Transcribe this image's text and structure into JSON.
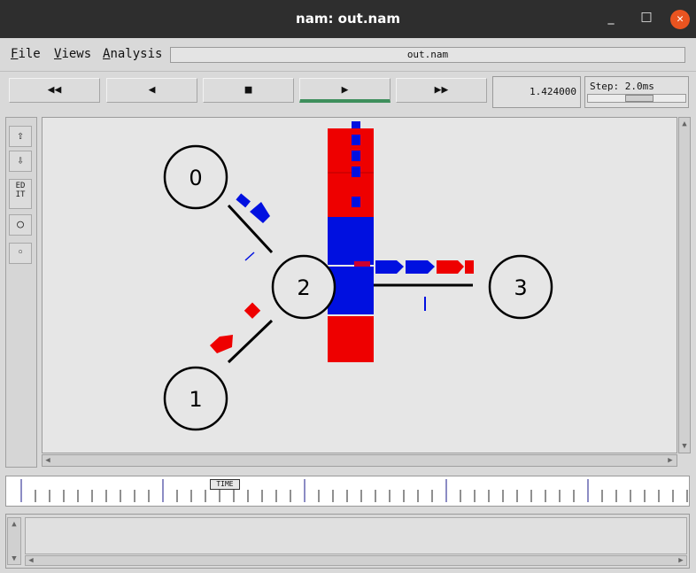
{
  "window": {
    "title": "nam: out.nam",
    "minimize": "_",
    "maximize": "□",
    "close": "✕"
  },
  "menu": {
    "file": {
      "key": "F",
      "rest": "ile"
    },
    "views": {
      "key": "V",
      "rest": "iews"
    },
    "analysis": {
      "key": "A",
      "rest": "nalysis"
    },
    "filename": "out.nam"
  },
  "controls": {
    "rewind": "◀◀",
    "back": "◀",
    "stop": "■",
    "play": "▶",
    "fast_forward": "▶▶",
    "current_time": "1.424000",
    "step_label": "Step: 2.0ms"
  },
  "tools": {
    "zoom_in_icon": "⇧",
    "zoom_out_icon": "⇩",
    "edit_label_line1": "ED",
    "edit_label_line2": "IT",
    "circle_tool": "○",
    "dot_tool": "◦"
  },
  "network": {
    "nodes": [
      {
        "id": "0",
        "label": "0"
      },
      {
        "id": "1",
        "label": "1"
      },
      {
        "id": "2",
        "label": "2"
      },
      {
        "id": "3",
        "label": "3"
      }
    ],
    "colors": {
      "flow_blue": "#0010e0",
      "flow_red": "#ee0000",
      "link": "#000000",
      "node_border": "#000000"
    }
  },
  "timeline": {
    "marker_label": "TIME"
  },
  "scroll_arrows": {
    "up": "▲",
    "down": "▼",
    "left": "◀",
    "right": "▶"
  }
}
